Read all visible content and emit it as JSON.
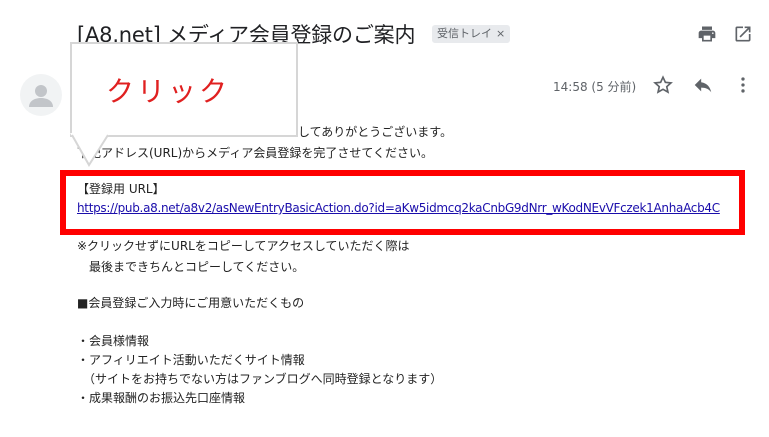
{
  "email": {
    "subject": "[A8.net] メディア会員登録のご案内",
    "label": "受信トレイ",
    "label_close": "×",
    "time": "14:58 (5 分前)",
    "icons": {
      "print": "print-icon",
      "open_new": "open-in-new-icon",
      "star": "star-icon",
      "reply": "reply-icon",
      "more": "more-vert-icon",
      "avatar": "avatar-icon"
    },
    "body": {
      "line1": "ましてありがとうございます。",
      "line2": "下記アドレス(URL)からメディア会員登録を完了させてください。",
      "url_heading": "【登録用 URL】",
      "url": "https://pub.a8.net/a8v2/asNewEntryBasicAction.do?id=aKw5idmcq2kaCnbG9dNrr_wKodNEvVFczek1AnhaAcb4C",
      "note1": "※クリックせずにURLをコピーしてアクセスしていただく際は",
      "note2": "　最後まできちんとコピーしてください。",
      "section": "■会員登録ご入力時にご用意いただくもの",
      "item1": "・会員様情報",
      "item2": "・アフィリエイト活動いただくサイト情報",
      "item2_sub": "　（サイトをお持ちでない方はファンブログへ同時登録となります）",
      "item3": "・成果報酬のお振込先口座情報"
    }
  },
  "annotation": {
    "callout_text": "クリック",
    "highlight_color": "#ff0000"
  }
}
